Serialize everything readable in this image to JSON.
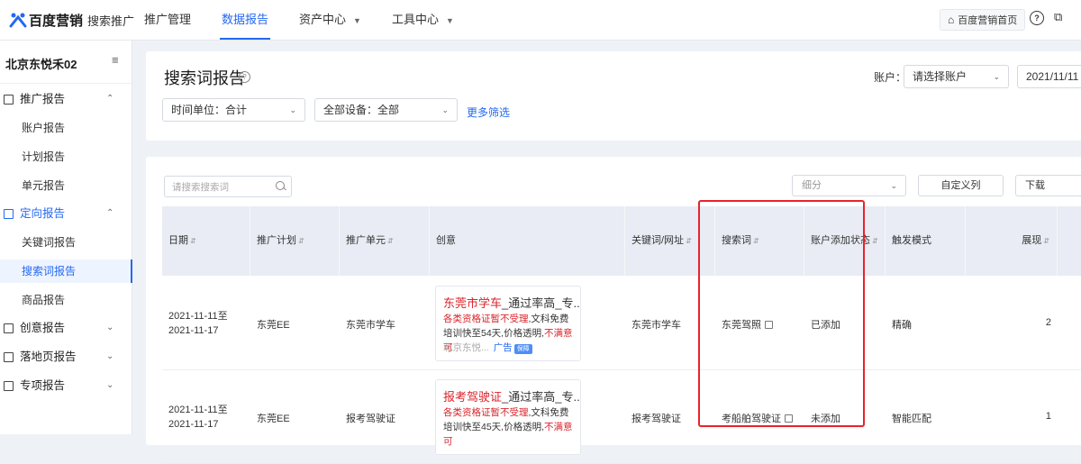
{
  "topbar": {
    "brand": "百度营销",
    "sub_brand": "搜索推广",
    "nav": [
      {
        "label": "推广管理"
      },
      {
        "label": "数据报告"
      },
      {
        "label": "资产中心"
      },
      {
        "label": "工具中心"
      }
    ],
    "home_button": "百度营销首页",
    "help_icon": "?"
  },
  "sidebar": {
    "account_name": "北京东悦禾02",
    "groups": [
      {
        "label": "推广报告",
        "expanded": true,
        "items": [
          "账户报告",
          "计划报告",
          "单元报告"
        ]
      },
      {
        "label": "定向报告",
        "expanded": true,
        "items": [
          "关键词报告",
          "搜索词报告",
          "商品报告"
        ]
      },
      {
        "label": "创意报告",
        "expanded": false
      },
      {
        "label": "落地页报告",
        "expanded": false
      },
      {
        "label": "专项报告",
        "expanded": false
      }
    ],
    "active_item": "搜索词报告"
  },
  "filters": {
    "page_title": "搜索词报告",
    "account_label": "账户：",
    "account_select": "请选择账户",
    "date_value": "2021/11/11",
    "time_unit": "时间单位：合计",
    "device": "全部设备：全部",
    "more_filters": "更多筛选"
  },
  "table": {
    "search_placeholder": "请搜索搜索词",
    "breakdown_select": "细分",
    "custom_columns": "自定义列",
    "download": "下载",
    "columns": [
      "日期",
      "推广计划",
      "推广单元",
      "创意",
      "关键词/网址",
      "搜索词",
      "账户添加状态",
      "触发模式",
      "展现"
    ],
    "rows": [
      {
        "date": "2021-11-11至2021-11-17",
        "plan": "东莞EE",
        "unit": "东莞市学车",
        "creative": {
          "title_red": "东莞市学车",
          "title_rest": "_通过率高_专...",
          "desc_red1": "各类资格证暂不受理",
          "desc_mid": ",文科免费培训快至54天,价格透明,",
          "desc_red2": "不满意可",
          "foot": "北京东悦...",
          "ad_label": "广告",
          "badge": "保障"
        },
        "keyword": "东莞市学车",
        "search_term": "东莞驾照",
        "status": "已添加",
        "match": "精确",
        "impressions": "2"
      },
      {
        "date": "2021-11-11至2021-11-17",
        "plan": "东莞EE",
        "unit": "报考驾驶证",
        "creative": {
          "title_red": "报考驾驶证",
          "title_rest": "_通过率高_专...",
          "desc_red1": "各类资格证暂不受理",
          "desc_mid": ",文科免费培训快至45天,价格透明,",
          "desc_red2": "不满意可",
          "foot": "",
          "ad_label": "",
          "badge": ""
        },
        "keyword": "报考驾驶证",
        "search_term": "考船舶驾驶证",
        "status": "未添加",
        "match": "智能匹配",
        "impressions": "1"
      }
    ]
  },
  "colors": {
    "accent": "#2468f2",
    "highlight": "#e8232b",
    "creative_red": "#d9232a"
  }
}
